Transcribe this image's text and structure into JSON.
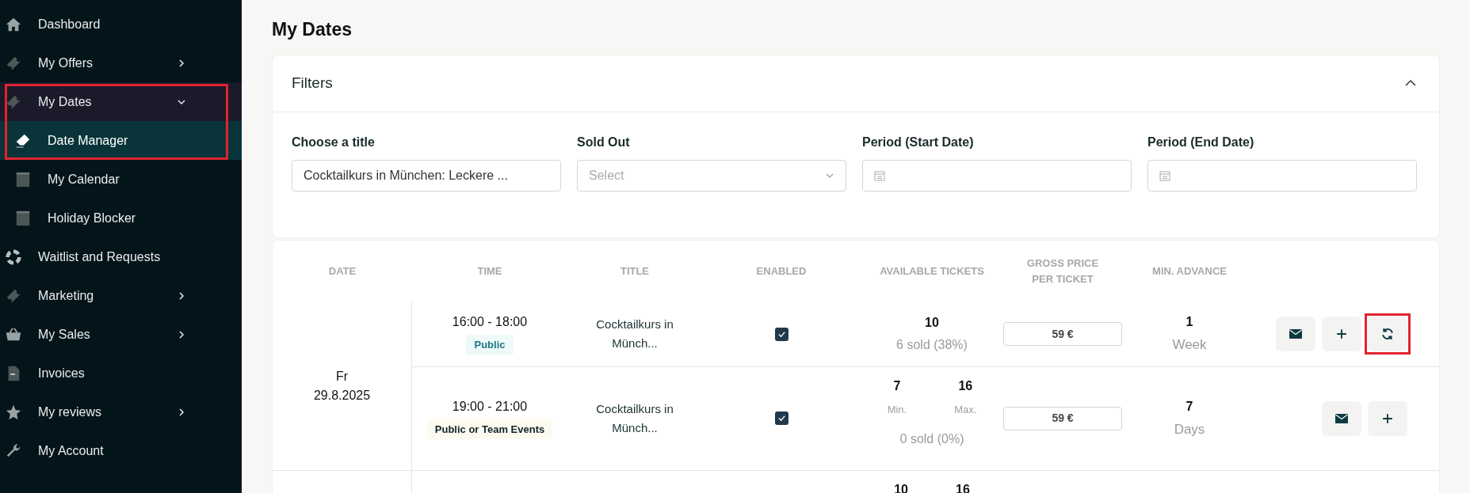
{
  "sidebar": {
    "items": [
      {
        "label": "Dashboard"
      },
      {
        "label": "My Offers",
        "submenu": true,
        "expanded": false
      },
      {
        "label": "My Dates",
        "submenu": true,
        "expanded": true,
        "highlighted": true,
        "children": [
          {
            "label": "Date Manager",
            "selected": true
          },
          {
            "label": "My Calendar",
            "selected": false
          },
          {
            "label": "Holiday Blocker",
            "selected": false
          }
        ]
      },
      {
        "label": "Waitlist and Requests"
      },
      {
        "label": "Marketing",
        "submenu": true,
        "expanded": false
      },
      {
        "label": "My Sales",
        "submenu": true,
        "expanded": false
      },
      {
        "label": "Invoices"
      },
      {
        "label": "My reviews",
        "submenu": true,
        "expanded": false
      },
      {
        "label": "My Account"
      }
    ]
  },
  "page": {
    "title": "My Dates"
  },
  "filters": {
    "title": "Filters",
    "expanded": true,
    "fields": [
      {
        "label": "Choose a title",
        "kind": "text",
        "value": "Cocktailkurs in München: Leckere ..."
      },
      {
        "label": "Sold Out",
        "kind": "select",
        "placeholder": "Select"
      },
      {
        "label": "Period (Start Date)",
        "kind": "date"
      },
      {
        "label": "Period (End Date)",
        "kind": "date"
      }
    ]
  },
  "table": {
    "columns": [
      "DATE",
      "TIME",
      "TITLE",
      "ENABLED",
      "AVAILABLE TICKETS",
      "GROSS PRICE PER TICKET",
      "MIN. ADVANCE"
    ],
    "groups": [
      {
        "day": "Fr",
        "date": "29.8.2025",
        "slots": [
          {
            "time": "16:00 - 18:00",
            "badge": {
              "text": "Public",
              "kind": "public"
            },
            "title": "Cocktailkurs in Münch...",
            "enabled": true,
            "tickets": {
              "kind": "single",
              "count": "10",
              "sold": "6 sold (38%)"
            },
            "price": "59 €",
            "advance": {
              "value": "1",
              "unit": "Week"
            },
            "actions": [
              {
                "kind": "mail"
              },
              {
                "kind": "add"
              },
              {
                "kind": "refresh",
                "highlighted": true
              }
            ]
          },
          {
            "time": "19:00 - 21:00",
            "badge": {
              "text": "Public or Team Events",
              "kind": "team"
            },
            "title": "Cocktailkurs in Münch...",
            "enabled": true,
            "tickets": {
              "kind": "range",
              "min": "7",
              "min_label": "Min.",
              "max": "16",
              "max_label": "Max.",
              "sold": "0 sold (0%)"
            },
            "price": "59 €",
            "advance": {
              "value": "7",
              "unit": "Days"
            },
            "actions": [
              {
                "kind": "mail"
              },
              {
                "kind": "add"
              }
            ]
          }
        ]
      },
      {
        "slots": [
          {
            "tickets": {
              "kind": "range",
              "min": "10",
              "max": "16"
            }
          }
        ]
      }
    ]
  }
}
